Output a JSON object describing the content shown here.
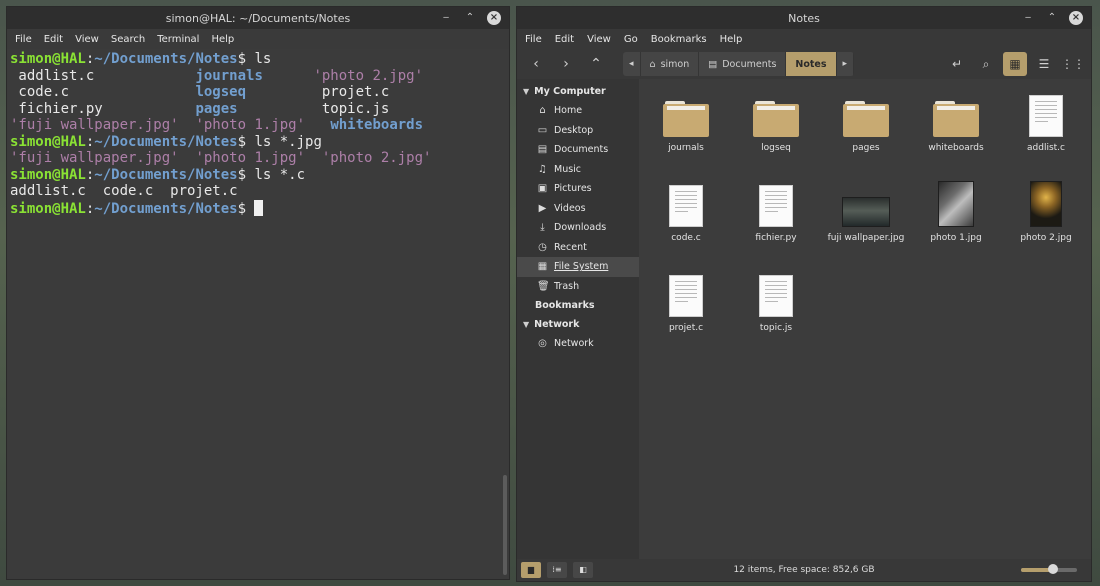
{
  "terminal": {
    "title": "simon@HAL: ~/Documents/Notes",
    "menu": [
      "File",
      "Edit",
      "View",
      "Search",
      "Terminal",
      "Help"
    ],
    "prompt_user": "simon@HAL",
    "prompt_path": "~/Documents/Notes",
    "lines": [
      {
        "kind": "prompt",
        "cmd": "ls"
      },
      {
        "kind": "out",
        "segments": [
          {
            "text": " addlist.c            ",
            "cls": ""
          },
          {
            "text": "journals",
            "cls": "dir"
          },
          {
            "text": "      ",
            "cls": ""
          },
          {
            "text": "'photo 2.jpg'",
            "cls": "img"
          }
        ]
      },
      {
        "kind": "out",
        "segments": [
          {
            "text": " code.c               ",
            "cls": ""
          },
          {
            "text": "logseq",
            "cls": "dir"
          },
          {
            "text": "         projet.c",
            "cls": ""
          }
        ]
      },
      {
        "kind": "out",
        "segments": [
          {
            "text": " fichier.py           ",
            "cls": ""
          },
          {
            "text": "pages",
            "cls": "dir"
          },
          {
            "text": "          topic.js",
            "cls": ""
          }
        ]
      },
      {
        "kind": "out",
        "segments": [
          {
            "text": "'fuji wallpaper.jpg'",
            "cls": "img"
          },
          {
            "text": "  ",
            "cls": ""
          },
          {
            "text": "'photo 1.jpg'",
            "cls": "img"
          },
          {
            "text": "   ",
            "cls": ""
          },
          {
            "text": "whiteboards",
            "cls": "dir"
          }
        ]
      },
      {
        "kind": "prompt",
        "cmd": "ls *.jpg"
      },
      {
        "kind": "out",
        "segments": [
          {
            "text": "'fuji wallpaper.jpg'",
            "cls": "img"
          },
          {
            "text": "  ",
            "cls": ""
          },
          {
            "text": "'photo 1.jpg'",
            "cls": "img"
          },
          {
            "text": "  ",
            "cls": ""
          },
          {
            "text": "'photo 2.jpg'",
            "cls": "img"
          }
        ]
      },
      {
        "kind": "prompt",
        "cmd": "ls *.c"
      },
      {
        "kind": "out",
        "segments": [
          {
            "text": "addlist.c  code.c  projet.c",
            "cls": ""
          }
        ]
      },
      {
        "kind": "prompt",
        "cmd": "",
        "cursor": true
      }
    ]
  },
  "files": {
    "title": "Notes",
    "menu": [
      "File",
      "Edit",
      "View",
      "Go",
      "Bookmarks",
      "Help"
    ],
    "breadcrumbs": [
      "simon",
      "Documents",
      "Notes"
    ],
    "sidebar": {
      "my_computer": "My Computer",
      "places": [
        {
          "label": "Home",
          "icon": "home-icon",
          "glyph": "⌂"
        },
        {
          "label": "Desktop",
          "icon": "desktop-icon",
          "glyph": "▭"
        },
        {
          "label": "Documents",
          "icon": "documents-icon",
          "glyph": "▤"
        },
        {
          "label": "Music",
          "icon": "music-icon",
          "glyph": "♫"
        },
        {
          "label": "Pictures",
          "icon": "pictures-icon",
          "glyph": "▣"
        },
        {
          "label": "Videos",
          "icon": "videos-icon",
          "glyph": "▶"
        },
        {
          "label": "Downloads",
          "icon": "downloads-icon",
          "glyph": "⤓"
        },
        {
          "label": "Recent",
          "icon": "recent-icon",
          "glyph": "◷"
        },
        {
          "label": "File System",
          "icon": "drive-icon",
          "glyph": "▦",
          "selected": true
        },
        {
          "label": "Trash",
          "icon": "trash-icon",
          "glyph": "🗑"
        }
      ],
      "bookmarks": "Bookmarks",
      "network_header": "Network",
      "network": [
        {
          "label": "Network",
          "icon": "network-icon",
          "glyph": "◎"
        }
      ]
    },
    "items": [
      {
        "name": "journals",
        "type": "folder"
      },
      {
        "name": "logseq",
        "type": "folder"
      },
      {
        "name": "pages",
        "type": "folder"
      },
      {
        "name": "whiteboards",
        "type": "folder"
      },
      {
        "name": "addlist.c",
        "type": "doc"
      },
      {
        "name": "code.c",
        "type": "doc"
      },
      {
        "name": "fichier.py",
        "type": "doc"
      },
      {
        "name": "fuji wallpaper.jpg",
        "type": "wallpaper"
      },
      {
        "name": "photo 1.jpg",
        "type": "photo1"
      },
      {
        "name": "photo 2.jpg",
        "type": "photo2"
      },
      {
        "name": "projet.c",
        "type": "doc"
      },
      {
        "name": "topic.js",
        "type": "doc"
      }
    ],
    "status": "12 items, Free space: 852,6 GB",
    "zoom_level": 0.58,
    "accent": "#b59e6c"
  }
}
